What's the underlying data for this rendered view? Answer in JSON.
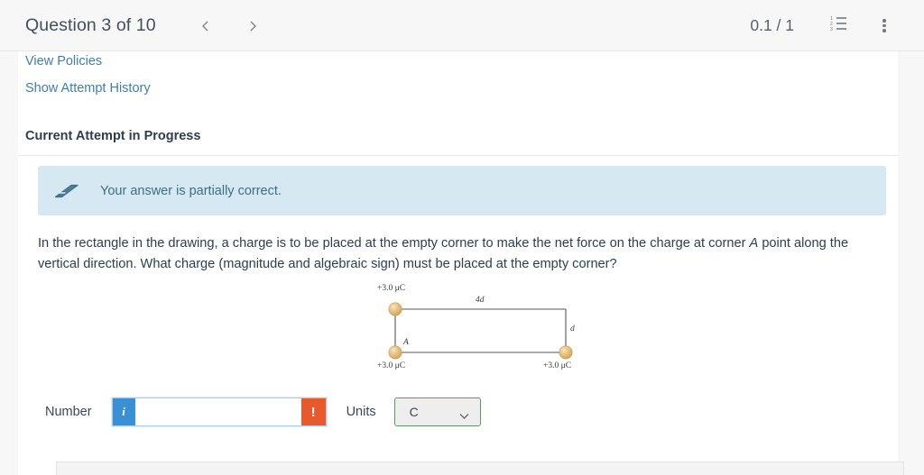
{
  "header": {
    "question_title": "Question 3 of 10",
    "prev_icon": "chevron-left-icon",
    "next_icon": "chevron-right-icon",
    "score": "0.1 / 1",
    "list_icon": "numbered-list-icon",
    "menu_icon": "kebab-menu-icon"
  },
  "links": {
    "view_policies": "View Policies",
    "show_attempt_history": "Show Attempt History"
  },
  "attempt": {
    "heading": "Current Attempt in Progress"
  },
  "alert": {
    "icon": "eraser-icon",
    "message": "Your answer is partially correct.",
    "background": "#d6e9f2",
    "text_color": "#3d6e86"
  },
  "question": {
    "part1": "In the rectangle in the drawing, a charge is to be placed at the empty corner to make the net force on the charge at corner ",
    "corner_label": "A",
    "part2": " point along the vertical direction. What charge (magnitude and algebraic sign) must be placed at the empty corner?"
  },
  "figure": {
    "alt": "rectangle-with-three-point-charges",
    "charges": [
      {
        "position": "top-left",
        "label": "+3.0 μC"
      },
      {
        "position": "bottom-left",
        "label": "+3.0 μC",
        "corner_name": "A"
      },
      {
        "position": "bottom-right",
        "label": "+3.0 μC"
      }
    ],
    "empty_corner": "top-right",
    "width_label": "4d",
    "height_label": "d",
    "corner_a_label": "A",
    "charge_color": "#e3b778",
    "line_color": "#555555"
  },
  "answer": {
    "number_label": "Number",
    "number_value": "",
    "number_placeholder": "",
    "info_button_label": "i",
    "warn_button_label": "!",
    "units_label": "Units",
    "units_value": "C",
    "units_options": [
      "C"
    ],
    "info_color": "#3b8fd4",
    "warn_color": "#e8592c",
    "units_border_color": "#5b9a63"
  }
}
